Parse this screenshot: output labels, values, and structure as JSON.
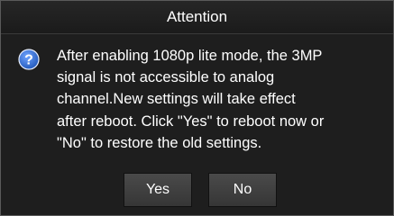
{
  "dialog": {
    "title": "Attention",
    "icon": "question-icon",
    "message": "After enabling 1080p lite mode, the 3MP\nsignal is not accessible to analog\nchannel.New settings will take effect\nafter reboot. Click \"Yes\" to reboot now or\n\"No\" to restore the old settings.",
    "buttons": {
      "yes_label": "Yes",
      "no_label": "No"
    }
  },
  "colors": {
    "icon_fill": "#1f56b8",
    "background": "#1e1e1e",
    "text": "#ffffff"
  }
}
